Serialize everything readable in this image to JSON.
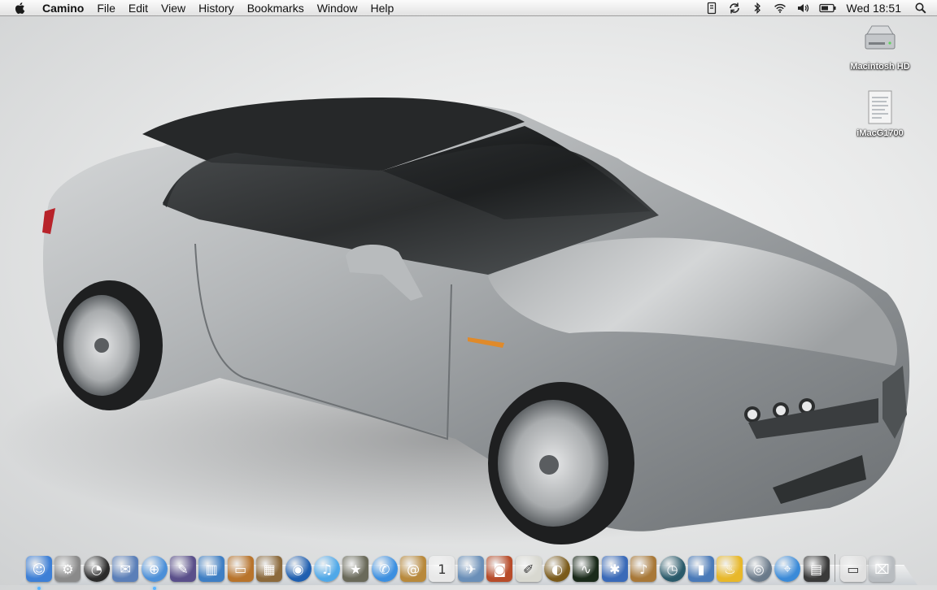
{
  "menubar": {
    "apple_icon": "apple-logo-icon",
    "app_name": "Camino",
    "menus": [
      "File",
      "Edit",
      "View",
      "History",
      "Bookmarks",
      "Window",
      "Help"
    ],
    "status_icons": [
      "time-machine-icon",
      "sync-icon",
      "bluetooth-icon",
      "wifi-icon",
      "volume-icon",
      "battery-icon"
    ],
    "clock": "Wed 18:51",
    "spotlight_icon": "spotlight-search-icon"
  },
  "desktop": {
    "wallpaper": "silver-alfa-romeo-brera-car",
    "icons": [
      {
        "label": "Macintosh HD",
        "icon": "hard-drive-icon"
      },
      {
        "label": "iMacG1700",
        "icon": "document-icon"
      }
    ]
  },
  "dock": {
    "apps": [
      {
        "icon": "finder-icon",
        "color": "#3d7fd6",
        "glyph": "☺"
      },
      {
        "icon": "system-preferences-icon",
        "color": "#8a8a8a",
        "glyph": "⚙"
      },
      {
        "icon": "dashboard-icon",
        "color": "#2b2b2b",
        "glyph": "◔"
      },
      {
        "icon": "mail-stamp-icon",
        "color": "#5b7fb8",
        "glyph": "✉"
      },
      {
        "icon": "network-utility-icon",
        "color": "#4b8fd8",
        "glyph": "⊕"
      },
      {
        "icon": "script-editor-icon",
        "color": "#5a4f8a",
        "glyph": "✎"
      },
      {
        "icon": "numbers-chart-icon",
        "color": "#3f7fc4",
        "glyph": "▥"
      },
      {
        "icon": "keynote-icon",
        "color": "#b8742c",
        "glyph": "▭"
      },
      {
        "icon": "iphoto-slides-icon",
        "color": "#8c6a3c",
        "glyph": "▦"
      },
      {
        "icon": "dvd-player-icon",
        "color": "#1f5fb0",
        "glyph": "◉"
      },
      {
        "icon": "itunes-icon",
        "color": "#4fa8e8",
        "glyph": "♫"
      },
      {
        "icon": "imovie-icon",
        "color": "#6a6a5a",
        "glyph": "★"
      },
      {
        "icon": "ichat-icon",
        "color": "#3c8fe0",
        "glyph": "✆"
      },
      {
        "icon": "address-book-icon",
        "color": "#b8893c",
        "glyph": "@"
      },
      {
        "icon": "ical-icon",
        "color": "#e8e8e8",
        "glyph": "1"
      },
      {
        "icon": "iphoto-icon",
        "color": "#6a8fb8",
        "glyph": "✈"
      },
      {
        "icon": "photo-booth-icon",
        "color": "#b84c2a",
        "glyph": "◙"
      },
      {
        "icon": "preview-icon",
        "color": "#d8d8d0",
        "glyph": "✐"
      },
      {
        "icon": "nmap-icon",
        "color": "#7a5a1a",
        "glyph": "◐"
      },
      {
        "icon": "activity-monitor-icon",
        "color": "#1a2a1a",
        "glyph": "∿"
      },
      {
        "icon": "bluetooth-app-icon",
        "color": "#3a6ab8",
        "glyph": "✱"
      },
      {
        "icon": "garageband-icon",
        "color": "#a87838",
        "glyph": "♪"
      },
      {
        "icon": "time-machine-app-icon",
        "color": "#2a5a6a",
        "glyph": "◷"
      },
      {
        "icon": "backup-icon",
        "color": "#4a7ab8",
        "glyph": "▮"
      },
      {
        "icon": "burn-icon",
        "color": "#e8b82a",
        "glyph": "♨"
      },
      {
        "icon": "quicktime-icon",
        "color": "#6a7a8a",
        "glyph": "◎"
      },
      {
        "icon": "safari-icon",
        "color": "#3a8ad8",
        "glyph": "⌖"
      },
      {
        "icon": "photo-browser-icon",
        "color": "#3a3a3a",
        "glyph": "▤"
      }
    ],
    "stacks": [
      {
        "icon": "documents-stack-icon",
        "color": "#e0e0e0",
        "glyph": "▭"
      },
      {
        "icon": "trash-icon",
        "color": "#b8bcc0",
        "glyph": "⌧"
      }
    ]
  }
}
